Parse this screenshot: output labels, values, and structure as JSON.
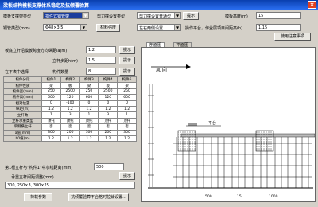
{
  "window": {
    "title": "梁板结构模板支撑体系稳定及抗倾覆验算",
    "close_label": "×"
  },
  "top": {
    "type_label": "模板支撑架类型",
    "type_value": "扣件式钢管架",
    "scaffold_type_label": "剪刀撑设置类型",
    "scaffold_type_value": "剪刀撑设置普通型",
    "hint_button": "提示",
    "height_label": "模板高度(m)",
    "height_value": "15",
    "tube_label": "钢管类型(mm)",
    "tube_value": "Φ48×3.5",
    "material_button": "材料强度",
    "side_label": "左右两侧设置",
    "factor_label": "操作平台，作业层项目间距高(h)",
    "factor_value": "1.15",
    "help_button": "使用注意事项"
  },
  "left": {
    "row1_label": "板底立杆沿模板跨度方向纵距la(m)",
    "row1_value": "1.2",
    "row1_btn": "提示",
    "row2_label": "立杆步距h(m)",
    "row2_value": "1.5",
    "row2_btn": "提示",
    "row3_label": "在下表中选择",
    "row3_mid": "构件数量",
    "row3_value": "8",
    "row3_btn": "提示",
    "table": {
      "headers": [
        "构件分段",
        "构件1",
        "构件2",
        "构件3",
        "构件4",
        "构件5"
      ],
      "rows": [
        [
          "构件性质",
          "梁",
          "板",
          "梁",
          "板",
          "梁"
        ],
        [
          "构件宽(mm)",
          "250",
          "2500",
          "250",
          "2500",
          "250"
        ],
        [
          "构件高(mm)",
          "600",
          "120",
          "600",
          "120",
          "600"
        ],
        [
          "相对位置",
          "0",
          "-100",
          "0",
          "0",
          "0"
        ],
        [
          "纵距(m)",
          "1.2",
          "1.2",
          "1.2",
          "1.2",
          "1.2"
        ],
        [
          "立杆数",
          "1",
          "3",
          "1",
          "3",
          "1"
        ],
        [
          "立杆承重类型",
          "顶托",
          "顶托",
          "顶托",
          "顶托",
          "顶托"
        ],
        [
          "梁侧横立杆",
          "否",
          "否",
          "否",
          "否",
          "否"
        ],
        [
          "a值(mm)",
          "300",
          "200",
          "300",
          "200",
          "300"
        ],
        [
          "h0值(m)",
          "1.2",
          "1.2",
          "1.2",
          "1.2",
          "1.2"
        ]
      ]
    },
    "row4_label": "第1根立杆与“构件1”中心线距离(mm)",
    "row4_value": "500",
    "row5_label": "承重立杆间距调整(mm)",
    "row5_btn": "提示",
    "row6_value": "300, 250×3, 300×25",
    "calc_button": "荷载参数",
    "check_button": "抗倾覆验算不合格时拉铺设置..."
  },
  "right": {
    "tab_elevation": "剖面图",
    "tab_plan": "平面图",
    "wind_label": "风 向",
    "platform_label": "平台",
    "dim_value": "500",
    "dim_value2": "15",
    "dim_value3": "1000"
  },
  "colors": {
    "titlebar": "#0a3fae",
    "accent_select": "#1a3c9c",
    "canvas_bg": "#ffffff"
  }
}
